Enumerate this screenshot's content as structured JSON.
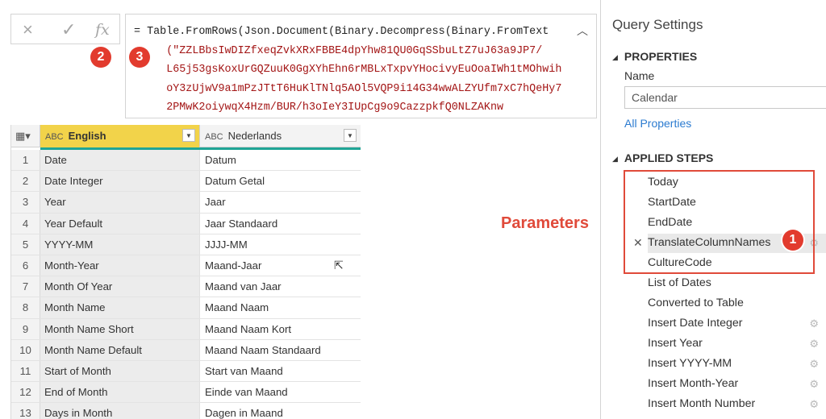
{
  "formula_bar": {
    "cancel_icon": "×",
    "commit_icon": "✓",
    "fx_icon": "fx",
    "lines": [
      "= Table.FromRows(Json.Document(Binary.Decompress(Binary.FromText",
      "(\"ZZLBbsIwDIZfxeqZvkXRxFBBE4dpYhw81QU0GqSSbuLtZ7uJ63a9JP7/",
      "L65j53gsKoxUrGQZuuK0GgXYhEhn6rMBLxTxpvYHocivyEuOoaIWh1tMOhwih",
      "oY3zUjwV9a1mPzJTtT6HuKlTNlq5AOl5VQP9i14G34wwALZYUfm7xC7hQeHy7",
      "2PMwK2oiywqX4Hzm/BUR/h3oIeY3IUpCg9o9CazzpkfQ0NLZAKnw"
    ],
    "collapse_icon": "chevron-up",
    "badge2": "2",
    "badge3": "3"
  },
  "table": {
    "columns": [
      {
        "type": "ABC",
        "name": "English"
      },
      {
        "type": "ABC",
        "name": "Nederlands"
      }
    ],
    "rows": [
      {
        "n": "1",
        "en": "Date",
        "nl": "Datum"
      },
      {
        "n": "2",
        "en": "Date Integer",
        "nl": "Datum Getal"
      },
      {
        "n": "3",
        "en": "Year",
        "nl": "Jaar"
      },
      {
        "n": "4",
        "en": "Year Default",
        "nl": "Jaar Standaard"
      },
      {
        "n": "5",
        "en": "YYYY-MM",
        "nl": "JJJJ-MM"
      },
      {
        "n": "6",
        "en": "Month-Year",
        "nl": "Maand-Jaar"
      },
      {
        "n": "7",
        "en": "Month Of Year",
        "nl": "Maand van Jaar"
      },
      {
        "n": "8",
        "en": "Month Name",
        "nl": "Maand Naam"
      },
      {
        "n": "9",
        "en": "Month Name Short",
        "nl": "Maand Naam Kort"
      },
      {
        "n": "10",
        "en": "Month Name Default",
        "nl": "Maand Naam Standaard"
      },
      {
        "n": "11",
        "en": "Start of Month",
        "nl": "Start van Maand"
      },
      {
        "n": "12",
        "en": "End of Month",
        "nl": "Einde van Maand"
      },
      {
        "n": "13",
        "en": "Days in Month",
        "nl": "Dagen in Maand"
      }
    ]
  },
  "annotation": {
    "parameters_label": "Parameters",
    "badge1": "1",
    "accent": "#e04a3a"
  },
  "query_settings": {
    "title": "Query Settings",
    "properties_header": "PROPERTIES",
    "name_label": "Name",
    "name_value": "Calendar",
    "all_properties_link": "All Properties",
    "applied_steps_header": "APPLIED STEPS",
    "steps": [
      "Today",
      "StartDate",
      "EndDate",
      "TranslateColumnNames",
      "CultureCode",
      "List of Dates",
      "Converted to Table",
      "Insert Date Integer",
      "Insert Year",
      "Insert YYYY-MM",
      "Insert Month-Year",
      "Insert Month Number"
    ],
    "selected_step": "TranslateColumnNames"
  }
}
